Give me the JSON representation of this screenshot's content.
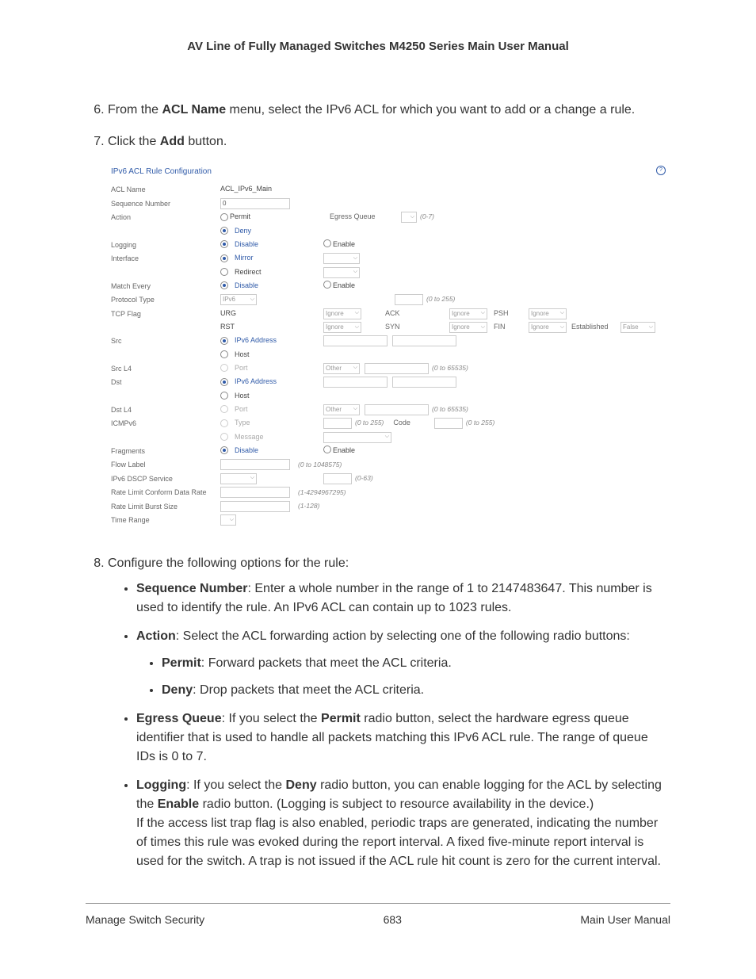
{
  "header": {
    "title": "AV Line of Fully Managed Switches M4250 Series Main User Manual"
  },
  "steps": {
    "s6": {
      "prefix": "From the ",
      "bold": "ACL Name",
      "rest": " menu, select the IPv6 ACL for which you want to add or a change a rule."
    },
    "s7": {
      "prefix": "Click the ",
      "bold": "Add",
      "rest": " button."
    },
    "s8": {
      "text": "Configure the following options for the rule:"
    }
  },
  "screenshot": {
    "title": "IPv6 ACL Rule Configuration",
    "rows": {
      "acl_name": {
        "label": "ACL Name",
        "value": "ACL_IPv6_Main"
      },
      "seq": {
        "label": "Sequence Number",
        "value": "0"
      },
      "action": {
        "label": "Action",
        "permit": "Permit",
        "deny": "Deny",
        "eq_label": "Egress Queue",
        "eq_hint": "(0-7)"
      },
      "logging": {
        "label": "Logging",
        "disable": "Disable",
        "enable": "Enable"
      },
      "interface": {
        "label": "Interface",
        "mirror": "Mirror",
        "redirect": "Redirect"
      },
      "match": {
        "label": "Match Every",
        "disable": "Disable",
        "enable": "Enable"
      },
      "protocol": {
        "label": "Protocol Type",
        "sel": "IPv6",
        "hint": "(0 to 255)"
      },
      "tcpflag": {
        "label": "TCP Flag",
        "urg": "URG",
        "rst": "RST",
        "ack": "ACK",
        "syn": "SYN",
        "psh": "PSH",
        "fin": "FIN",
        "est": "Established",
        "ignore": "Ignore",
        "false": "False"
      },
      "src": {
        "label": "Src",
        "ipv6": "IPv6 Address",
        "host": "Host"
      },
      "srcl4": {
        "label": "Src L4",
        "port": "Port",
        "other": "Other",
        "hint": "(0 to 65535)"
      },
      "dst": {
        "label": "Dst",
        "ipv6": "IPv6 Address",
        "host": "Host"
      },
      "dstl4": {
        "label": "Dst L4",
        "port": "Port",
        "other": "Other",
        "hint": "(0 to 65535)"
      },
      "icmpv6": {
        "label": "ICMPv6",
        "type": "Type",
        "message": "Message",
        "hint1": "(0 to 255)",
        "code": "Code",
        "hint2": "(0 to 255)"
      },
      "fragments": {
        "label": "Fragments",
        "disable": "Disable",
        "enable": "Enable"
      },
      "flowlabel": {
        "label": "Flow Label",
        "hint": "(0 to 1048575)"
      },
      "dscp": {
        "label": "IPv6 DSCP Service",
        "hint": "(0-63)"
      },
      "rate_conform": {
        "label": "Rate Limit Conform Data Rate",
        "hint": "(1-4294967295)"
      },
      "rate_burst": {
        "label": "Rate Limit Burst Size",
        "hint": "(1-128)"
      },
      "time_range": {
        "label": "Time Range"
      }
    }
  },
  "bullets": {
    "seq": {
      "b": "Sequence Number",
      "t": ": Enter a whole number in the range of 1 to 2147483647. This number is used to identify the rule. An IPv6 ACL can contain up to 1023 rules."
    },
    "action": {
      "b": "Action",
      "t": ": Select the ACL forwarding action by selecting one of the following radio buttons:"
    },
    "permit": {
      "b": "Permit",
      "t": ": Forward packets that meet the ACL criteria."
    },
    "deny": {
      "b": "Deny",
      "t": ": Drop packets that meet the ACL criteria."
    },
    "eq": {
      "b": "Egress Queue",
      "t1": ": If you select the ",
      "b2": "Permit",
      "t2": " radio button, select the hardware egress queue identifier that is used to handle all packets matching this IPv6 ACL rule. The range of queue IDs is 0 to 7."
    },
    "log": {
      "b": "Logging",
      "t1": ": If you select the ",
      "b2": "Deny",
      "t2": " radio button, you can enable logging for the ACL by selecting the ",
      "b3": "Enable",
      "t3": " radio button. (Logging is subject to resource availability in the device.)",
      "p2": "If the access list trap flag is also enabled, periodic traps are generated, indicating the number of times this rule was evoked during the report interval. A fixed five-minute report interval is used for the switch. A trap is not issued if the ACL rule hit count is zero for the current interval."
    }
  },
  "footer": {
    "left": "Manage Switch Security",
    "center": "683",
    "right": "Main User Manual"
  }
}
